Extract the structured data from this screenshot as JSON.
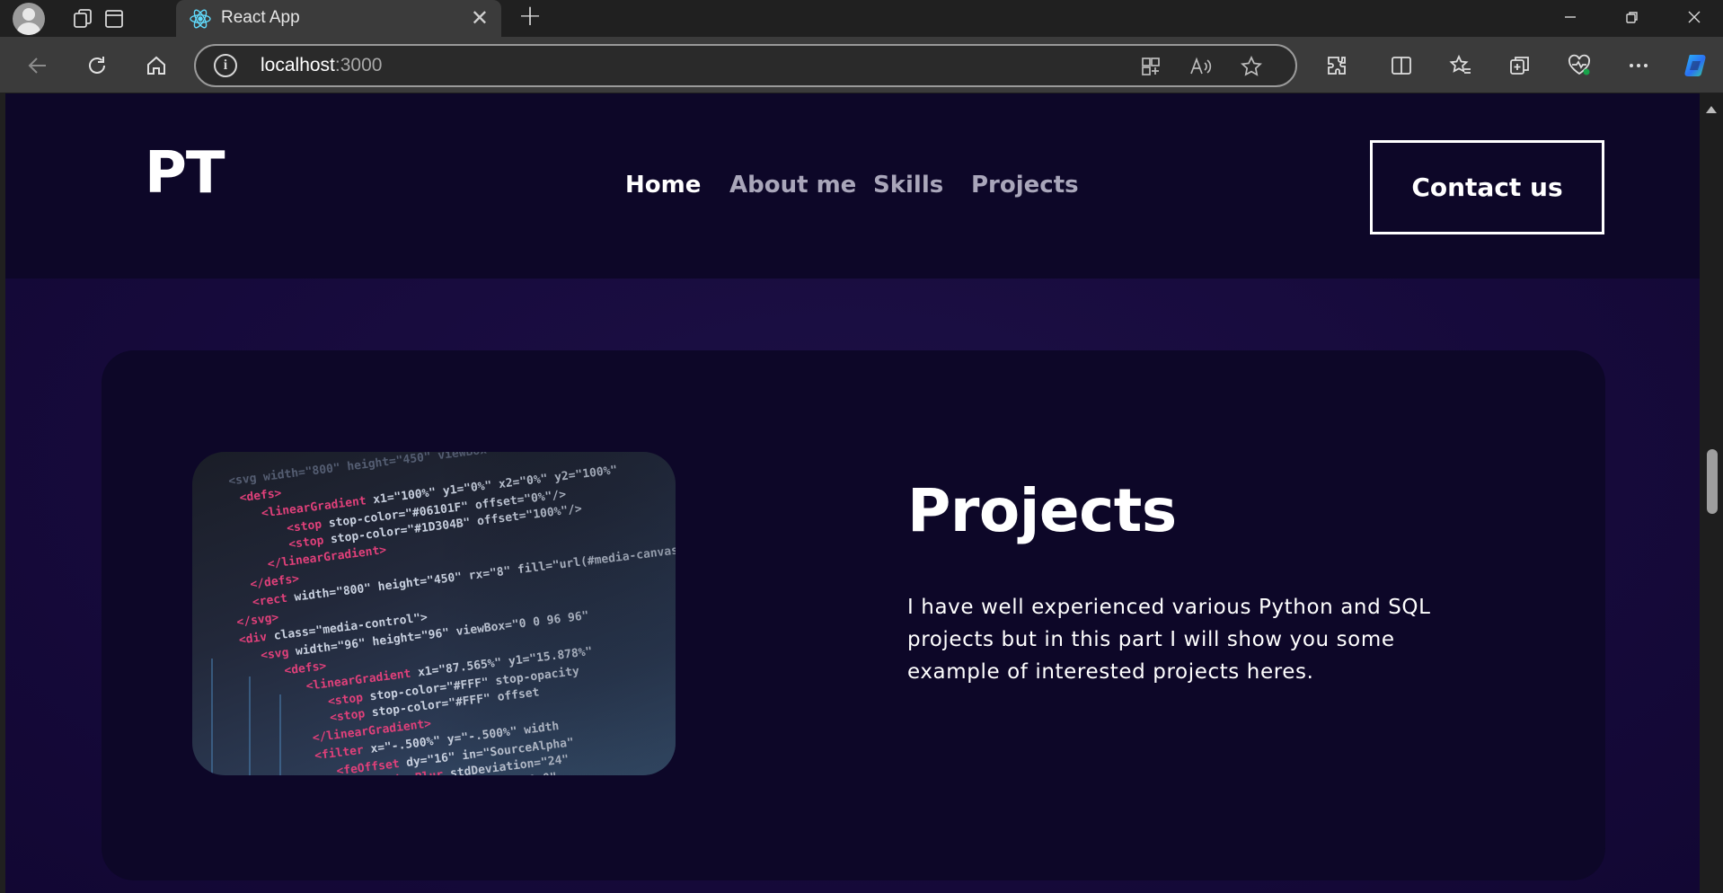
{
  "browser": {
    "tab": {
      "title": "React App",
      "favicon": "react-logo-icon"
    },
    "address_bar": {
      "host": "localhost",
      "port": ":3000"
    }
  },
  "navbar": {
    "logo": "PT",
    "links": [
      {
        "label": "Home",
        "active": true
      },
      {
        "label": "About me",
        "active": false
      },
      {
        "label": "Skills",
        "active": false
      },
      {
        "label": "Projects",
        "active": false
      }
    ],
    "contact_label": "Contact us"
  },
  "projects": {
    "title": "Projects",
    "description": "I have well experienced various Python and SQL projects but in this part I will show you some example of interested projects heres.",
    "image_icon": "code-screenshot-image"
  },
  "colors": {
    "page_background": "#130c36",
    "navbar_background": "#0d0728",
    "card_background": "#0d0728",
    "nav_link_inactive": "#a9a6ba",
    "text_primary": "#ffffff"
  }
}
